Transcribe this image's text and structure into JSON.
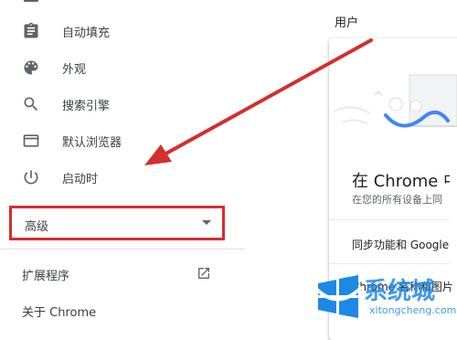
{
  "sidebar": {
    "items": [
      {
        "label": "自动填充",
        "icon": "clipboard-icon"
      },
      {
        "label": "外观",
        "icon": "palette-icon"
      },
      {
        "label": "搜索引擎",
        "icon": "search-icon"
      },
      {
        "label": "默认浏览器",
        "icon": "browser-icon"
      },
      {
        "label": "启动时",
        "icon": "power-icon"
      }
    ],
    "advanced_label": "高级",
    "extensions_label": "扩展程序",
    "about_label": "关于 Chrome"
  },
  "main": {
    "section_title": "用户",
    "card_heading": "在 Chrome 中畅",
    "card_sub": "在您的所有设备上同",
    "sync_label": "同步功能和 Google 服",
    "name_label": "Chrome 名称和图片"
  },
  "watermark": {
    "text": "系统城",
    "url": "xitongcheng.com"
  },
  "colors": {
    "highlight_red": "#d32f2f",
    "watermark_blue": "#1e88e5",
    "icon_gray": "#5f6368"
  }
}
